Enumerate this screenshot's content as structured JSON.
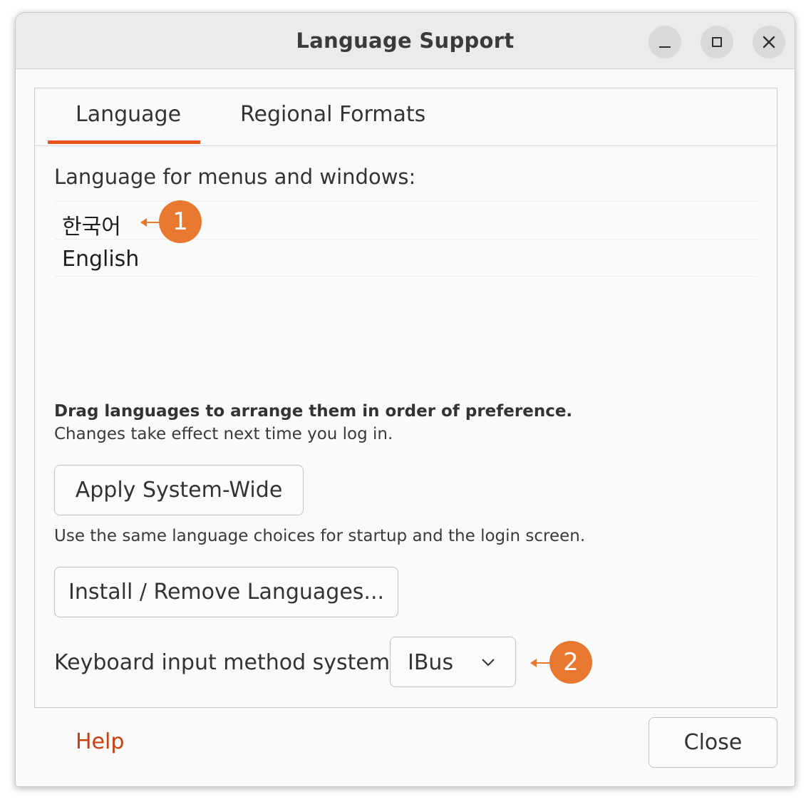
{
  "window": {
    "title": "Language Support",
    "controls": {
      "minimize": "minimize-icon",
      "maximize": "maximize-icon",
      "close": "close-icon"
    }
  },
  "tabs": [
    {
      "label": "Language",
      "selected": true
    },
    {
      "label": "Regional Formats",
      "selected": false
    }
  ],
  "language_tab": {
    "section_label": "Language for menus and windows:",
    "languages": [
      "한국어",
      "English"
    ],
    "hint_bold": "Drag languages to arrange them in order of preference.",
    "hint": "Changes take effect next time you log in.",
    "apply_button": "Apply System-Wide",
    "apply_description": "Use the same language choices for startup and the login screen.",
    "install_button": "Install / Remove Languages...",
    "keyboard_label": "Keyboard input method system:",
    "keyboard_value": "IBus"
  },
  "footer": {
    "help": "Help",
    "close": "Close"
  },
  "callouts": [
    "1",
    "2"
  ],
  "colors": {
    "accent": "#e95420",
    "callout": "#e8782f",
    "help_link": "#c7400e"
  }
}
